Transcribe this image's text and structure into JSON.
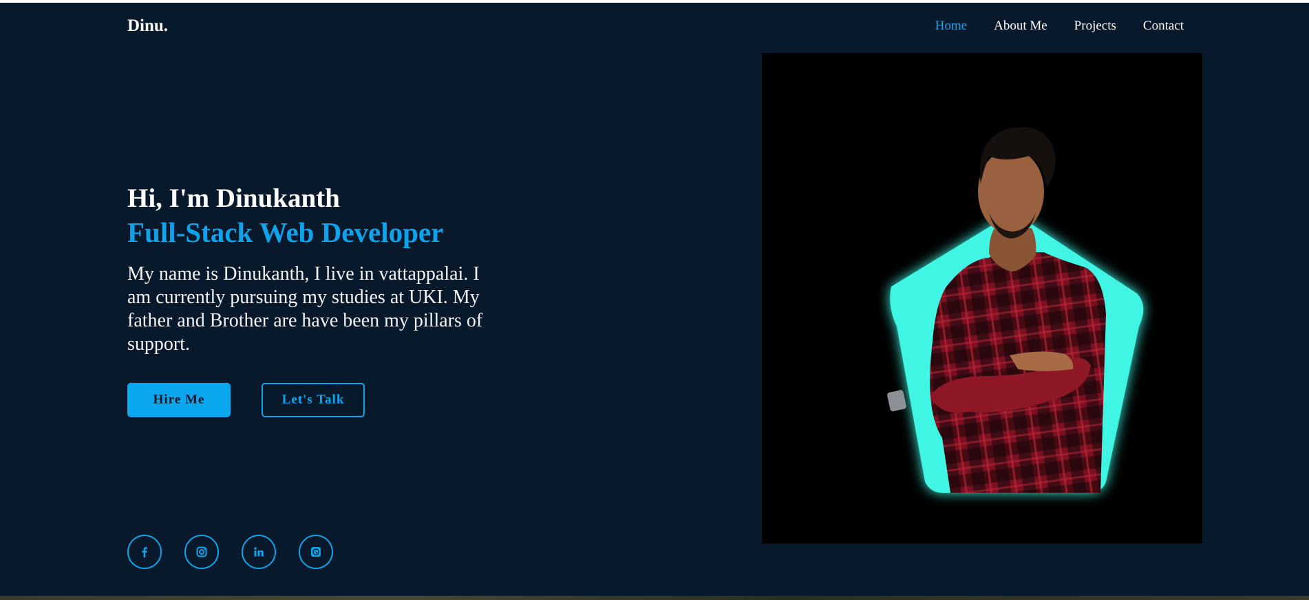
{
  "brand": {
    "logo": "Dinu."
  },
  "nav": {
    "items": [
      {
        "label": "Home",
        "active": true
      },
      {
        "label": "About Me",
        "active": false
      },
      {
        "label": "Projects",
        "active": false
      },
      {
        "label": "Contact",
        "active": false
      }
    ]
  },
  "hero": {
    "greeting": "Hi, I'm Dinukanth",
    "role": "Full-Stack Web Developer",
    "bio": "My name is Dinukanth, I live in vattappalai. I am currently pursuing my studies at UKI. My father and Brother are have been my pillars of support.",
    "primary_button": "Hire Me",
    "secondary_button": "Let's Talk"
  },
  "socials": [
    {
      "icon": "facebook-icon"
    },
    {
      "icon": "instagram-icon"
    },
    {
      "icon": "linkedin-icon"
    },
    {
      "icon": "whatsapp-icon"
    }
  ],
  "colors": {
    "background": "#07192a",
    "accent": "#0aa6ee",
    "highlight_shape": "#3ff5e3",
    "text": "#ffffff"
  }
}
